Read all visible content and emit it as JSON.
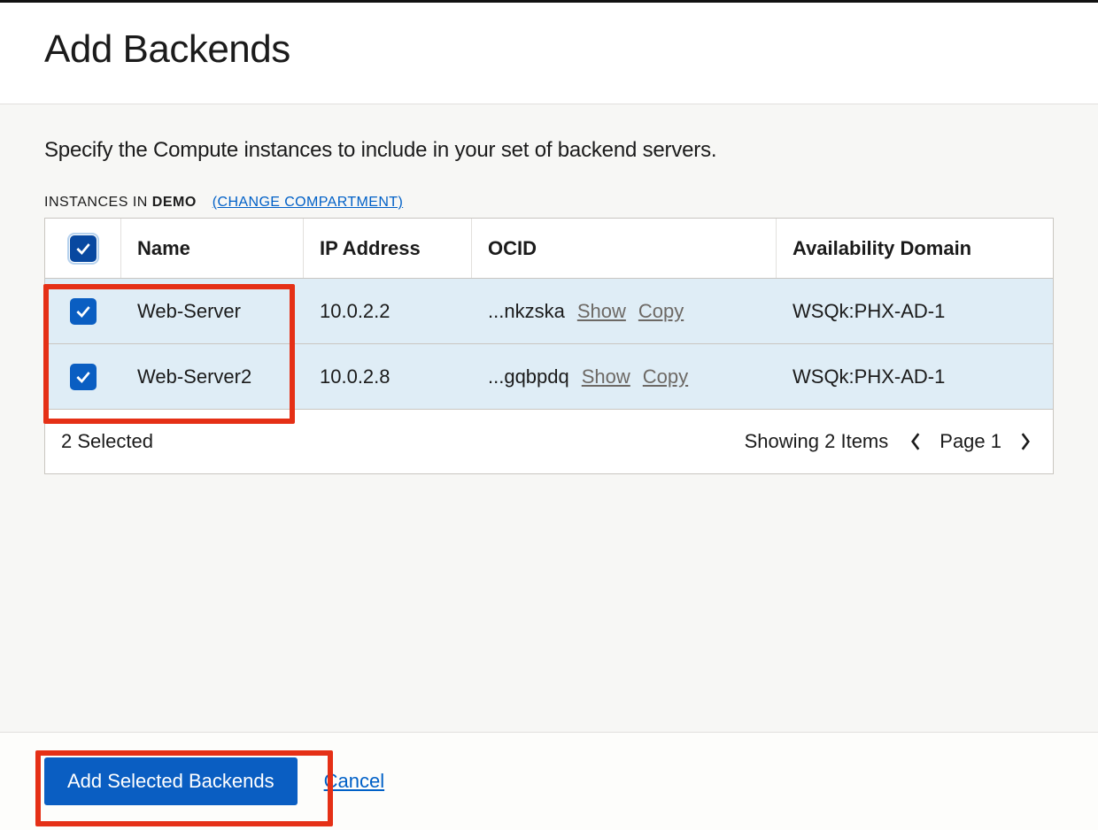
{
  "header": {
    "title": "Add Backends"
  },
  "intro": "Specify the Compute instances to include in your set of backend servers.",
  "compartment": {
    "prefix": "INSTANCES IN ",
    "name": "DEMO",
    "change_link": "(CHANGE COMPARTMENT)"
  },
  "table": {
    "columns": {
      "name": "Name",
      "ip": "IP Address",
      "ocid": "OCID",
      "ad": "Availability Domain"
    },
    "show_label": "Show",
    "copy_label": "Copy",
    "rows": [
      {
        "checked": true,
        "name": "Web-Server",
        "ip": "10.0.2.2",
        "ocid_tail": "...nkzska",
        "ad": "WSQk:PHX-AD-1"
      },
      {
        "checked": true,
        "name": "Web-Server2",
        "ip": "10.0.2.8",
        "ocid_tail": "...gqbpdq",
        "ad": "WSQk:PHX-AD-1"
      }
    ]
  },
  "footer_row": {
    "selected_text": "2 Selected",
    "showing_text": "Showing 2 Items",
    "page_text": "Page 1"
  },
  "actions": {
    "add": "Add Selected Backends",
    "cancel": "Cancel"
  }
}
